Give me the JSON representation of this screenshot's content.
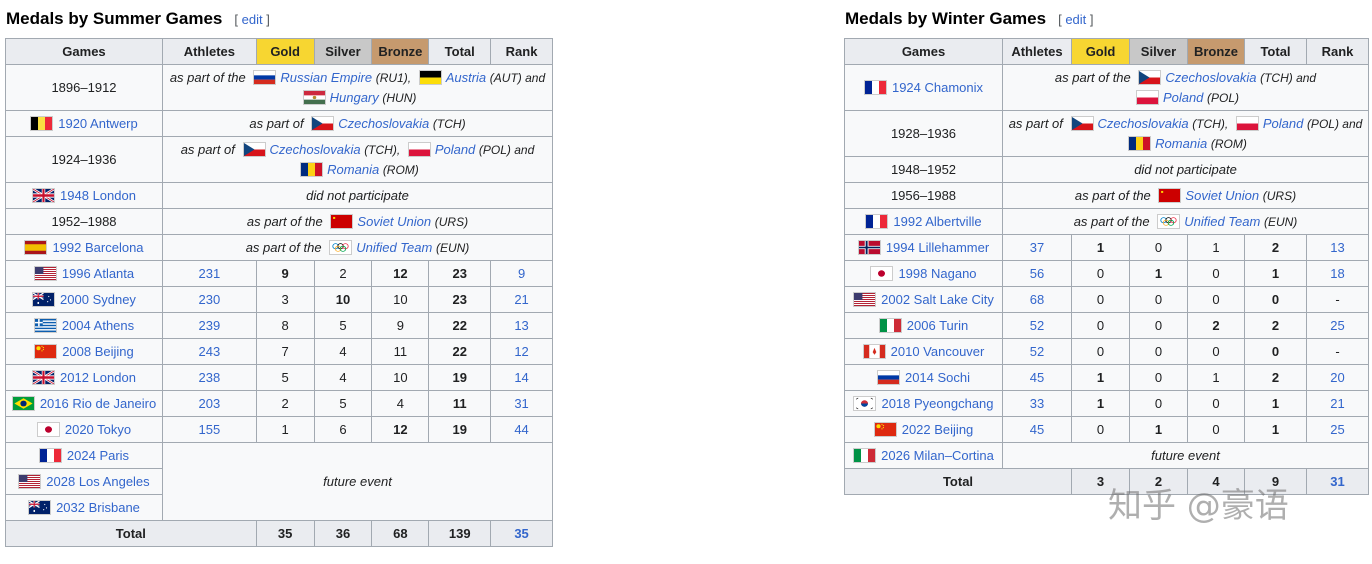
{
  "summer": {
    "heading": "Medals by Summer Games",
    "edit_label": "edit",
    "headers": [
      "Games",
      "Athletes",
      "Gold",
      "Silver",
      "Bronze",
      "Total",
      "Rank"
    ],
    "notes": {
      "r1_a": "as part of the",
      "r1_country1": "Russian Empire",
      "r1_code1": "(RU1),",
      "r1_country2": "Austria",
      "r1_code2": "(AUT) and",
      "r1_country3": "Hungary",
      "r1_code3": "(HUN)",
      "r2_a": "as part of",
      "r2_country": "Czechoslovakia",
      "r2_code": "(TCH)",
      "r3_a": "as part of",
      "r3_country1": "Czechoslovakia",
      "r3_code1": "(TCH),",
      "r3_country2": "Poland",
      "r3_code2": "(POL) and",
      "r3_country3": "Romania",
      "r3_code3": "(ROM)",
      "r4": "did not participate",
      "r5_a": "as part of the",
      "r5_country": "Soviet Union",
      "r5_code": "(URS)",
      "r6_a": "as part of the",
      "r6_country": "Unified Team",
      "r6_code": "(EUN)",
      "future": "future event"
    },
    "games": [
      "1896–1912",
      "1920 Antwerp",
      "1924–1936",
      "1948 London",
      "1952–1988",
      "1992 Barcelona",
      "1996 Atlanta",
      "2000 Sydney",
      "2004 Athens",
      "2008 Beijing",
      "2012 London",
      "2016 Rio de Janeiro",
      "2020 Tokyo",
      "2024 Paris",
      "2028 Los Angeles",
      "2032 Brisbane"
    ],
    "rows": [
      [
        "231",
        "9",
        "2",
        "12",
        "23",
        "9"
      ],
      [
        "230",
        "3",
        "10",
        "10",
        "23",
        "21"
      ],
      [
        "239",
        "8",
        "5",
        "9",
        "22",
        "13"
      ],
      [
        "243",
        "7",
        "4",
        "11",
        "22",
        "12"
      ],
      [
        "238",
        "5",
        "4",
        "10",
        "19",
        "14"
      ],
      [
        "203",
        "2",
        "5",
        "4",
        "11",
        "31"
      ],
      [
        "155",
        "1",
        "6",
        "12",
        "19",
        "44"
      ]
    ],
    "total": {
      "label": "Total",
      "gold": "35",
      "silver": "36",
      "bronze": "68",
      "total": "139",
      "rank": "35"
    }
  },
  "winter": {
    "heading": "Medals by Winter Games",
    "edit_label": "edit",
    "headers": [
      "Games",
      "Athletes",
      "Gold",
      "Silver",
      "Bronze",
      "Total",
      "Rank"
    ],
    "notes": {
      "r1_a": "as part of the",
      "r1_country1": "Czechoslovakia",
      "r1_code1": "(TCH) and",
      "r1_country2": "Poland",
      "r1_code2": "(POL)",
      "r2_a": "as part of",
      "r2_country1": "Czechoslovakia",
      "r2_code1": "(TCH),",
      "r2_country2": "Poland",
      "r2_code2": "(POL) and",
      "r2_country3": "Romania",
      "r2_code3": "(ROM)",
      "r3": "did not participate",
      "r4_a": "as part of the",
      "r4_country": "Soviet Union",
      "r4_code": "(URS)",
      "r5_a": "as part of the",
      "r5_country": "Unified Team",
      "r5_code": "(EUN)",
      "future": "future event"
    },
    "games": [
      "1924 Chamonix",
      "1928–1936",
      "1948–1952",
      "1956–1988",
      "1992 Albertville",
      "1994 Lillehammer",
      "1998 Nagano",
      "2002 Salt Lake City",
      "2006 Turin",
      "2010 Vancouver",
      "2014 Sochi",
      "2018 Pyeongchang",
      "2022 Beijing",
      "2026 Milan–Cortina"
    ],
    "rows": [
      [
        "37",
        "1",
        "0",
        "1",
        "2",
        "13"
      ],
      [
        "56",
        "0",
        "1",
        "0",
        "1",
        "18"
      ],
      [
        "68",
        "0",
        "0",
        "0",
        "0",
        "-"
      ],
      [
        "52",
        "0",
        "0",
        "2",
        "2",
        "25"
      ],
      [
        "52",
        "0",
        "0",
        "0",
        "0",
        "-"
      ],
      [
        "45",
        "1",
        "0",
        "1",
        "2",
        "20"
      ],
      [
        "33",
        "1",
        "0",
        "0",
        "1",
        "21"
      ],
      [
        "45",
        "0",
        "1",
        "0",
        "1",
        "25"
      ]
    ],
    "total": {
      "label": "Total",
      "gold": "3",
      "silver": "2",
      "bronze": "4",
      "total": "9",
      "rank": "31"
    }
  },
  "watermark": "知乎 @豪语"
}
